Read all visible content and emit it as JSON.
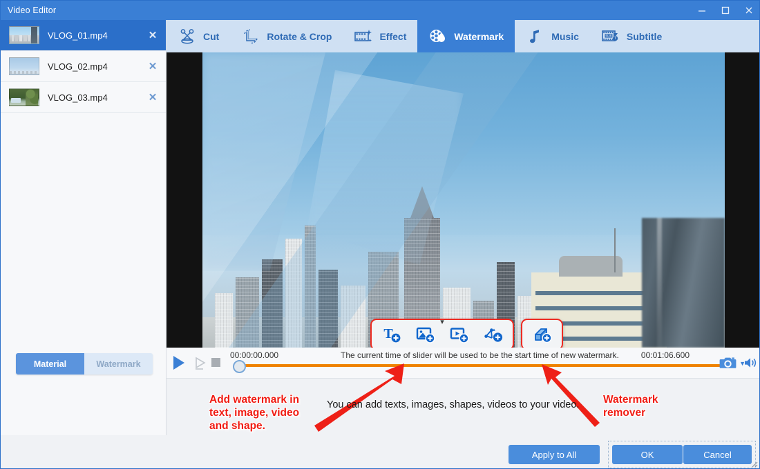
{
  "window": {
    "title": "Video Editor",
    "controls": [
      {
        "name": "minimize",
        "glyph": "minimize-icon"
      },
      {
        "name": "maximize",
        "glyph": "maximize-icon"
      },
      {
        "name": "close",
        "glyph": "close-icon"
      }
    ]
  },
  "sidebar": {
    "media": [
      {
        "name": "VLOG_01.mp4",
        "selected": true,
        "thumb": "city-thumbnail",
        "close": "✕"
      },
      {
        "name": "VLOG_02.mp4",
        "selected": false,
        "thumb": "sky-thumbnail",
        "close": "✕"
      },
      {
        "name": "VLOG_03.mp4",
        "selected": false,
        "thumb": "garden-thumbnail",
        "close": "✕"
      }
    ],
    "tabs": [
      {
        "label": "Material",
        "active": true
      },
      {
        "label": "Watermark",
        "active": false
      }
    ]
  },
  "toolbar": {
    "tabs": [
      {
        "label": "Cut",
        "icon": "scissors-icon",
        "active": false
      },
      {
        "label": "Rotate & Crop",
        "icon": "rotate-crop-icon",
        "active": false
      },
      {
        "label": "Effect",
        "icon": "film-sparkle-icon",
        "active": false
      },
      {
        "label": "Watermark",
        "icon": "film-reel-drop-icon",
        "active": true
      },
      {
        "label": "Music",
        "icon": "music-note-icon",
        "active": false
      },
      {
        "label": "Subtitle",
        "icon": "subtitle-icon",
        "active": false
      }
    ]
  },
  "watermark_tools": {
    "group_label": "add-watermark-group",
    "buttons": [
      {
        "name": "add-text-watermark",
        "icon": "text-plus-icon"
      },
      {
        "name": "add-image-watermark",
        "icon": "image-plus-icon"
      },
      {
        "name": "add-video-watermark",
        "icon": "video-plus-icon"
      },
      {
        "name": "add-shape-watermark",
        "icon": "shape-plus-icon"
      }
    ],
    "remover": {
      "name": "watermark-remover",
      "icon": "eraser-block-plus-icon"
    }
  },
  "transport": {
    "play_label": "play-icon",
    "playback_label": "playback-icon",
    "stop_label": "stop-icon",
    "current_time": "00:00:00.000",
    "total_time": "00:01:06.600",
    "hint": "The current time of slider will be used to be the start time of new watermark.",
    "snapshot_icon": "camera-icon",
    "snapshot_caret": "▼",
    "volume_icon": "volume-icon",
    "progress_percent": 0,
    "track_color": "#ef8200"
  },
  "annotations": {
    "left": "Add watermark in\ntext, image, video\nand shape.",
    "right": "Watermark\nremover",
    "center_note": "You can add texts, images, shapes, videos to your video.",
    "color": "#f01b12"
  },
  "footer": {
    "apply_to_all": "Apply to All",
    "ok": "OK",
    "cancel": "Cancel"
  },
  "colors": {
    "title_bar": "#3a7fd5",
    "accent": "#2b6fc9",
    "tab_bar": "#cfe0f3",
    "tab_active": "#3a7fd5",
    "button": "#4a8ddc",
    "annotation_red": "#f01b12",
    "timeline_orange": "#ef8200"
  }
}
